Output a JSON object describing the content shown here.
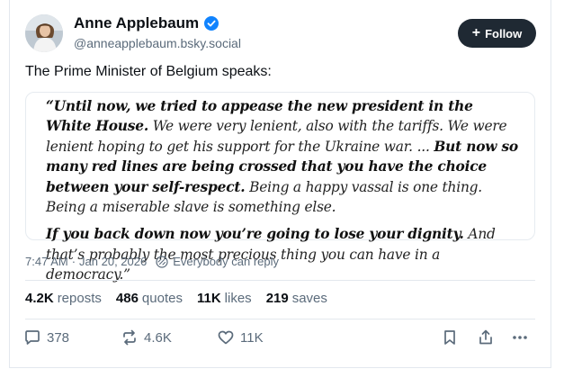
{
  "author": {
    "display_name": "Anne Applebaum",
    "handle": "@anneapplebaum.bsky.social",
    "verified": true
  },
  "follow_button": {
    "label": "Follow",
    "icon": "plus-icon"
  },
  "post": {
    "text": "The Prime Minister of Belgium speaks:",
    "quote_image": {
      "p1_bold_1": "“Until now, we tried to appease the new president in the White House.",
      "p1_reg_1": " We were very lenient, also with the tariffs. We were lenient hoping to get his support for the Ukraine war. ... ",
      "p1_bold_2": "But now so many red lines are being crossed that you have the choice between your self-respect.",
      "p1_reg_2": " Being a happy vassal is one thing. Being a miserable slave is something else.",
      "p2_bold": "If you back down now you’re going to lose your dignity.",
      "p2_reg": " And that’s probably the most precious thing you can have in a democracy.”"
    }
  },
  "meta": {
    "time": "7:47 AM",
    "separator": "·",
    "date": "Jan 20, 2026",
    "reply_setting": "Everybody can reply"
  },
  "stats": {
    "reposts": {
      "count": "4.2K",
      "label": "reposts"
    },
    "quotes": {
      "count": "486",
      "label": "quotes"
    },
    "likes": {
      "count": "11K",
      "label": "likes"
    },
    "saves": {
      "count": "219",
      "label": "saves"
    }
  },
  "actions": {
    "reply_count": "378",
    "repost_count": "4.6K",
    "like_count": "11K"
  },
  "colors": {
    "follow_bg": "#1f2933",
    "verified": "#1083fe",
    "muted_text": "#5b6b7b",
    "border": "#e3e8ee"
  }
}
